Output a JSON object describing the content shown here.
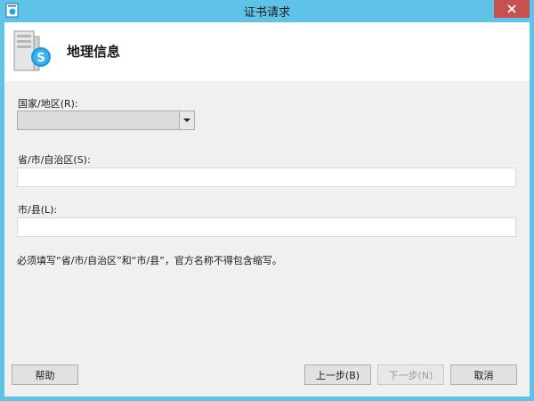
{
  "window": {
    "title": "证书请求"
  },
  "header": {
    "title": "地理信息"
  },
  "form": {
    "country": {
      "label": "国家/地区(R):",
      "value": ""
    },
    "province": {
      "label": "省/市/自治区(S):",
      "value": ""
    },
    "city": {
      "label": "市/县(L):",
      "value": ""
    },
    "note": "必须填写“省/市/自治区”和“市/县”，官方名称不得包含缩写。"
  },
  "buttons": {
    "help": "帮助",
    "back": "上一步(B)",
    "next": "下一步(N)",
    "cancel": "取消"
  },
  "colors": {
    "title_bar": "#5fc3e8",
    "close_button": "#c75050",
    "content_bg": "#f0f0f0"
  },
  "icons": [
    "app-icon",
    "close-icon",
    "server-skype-icon",
    "dropdown-arrow-icon"
  ]
}
